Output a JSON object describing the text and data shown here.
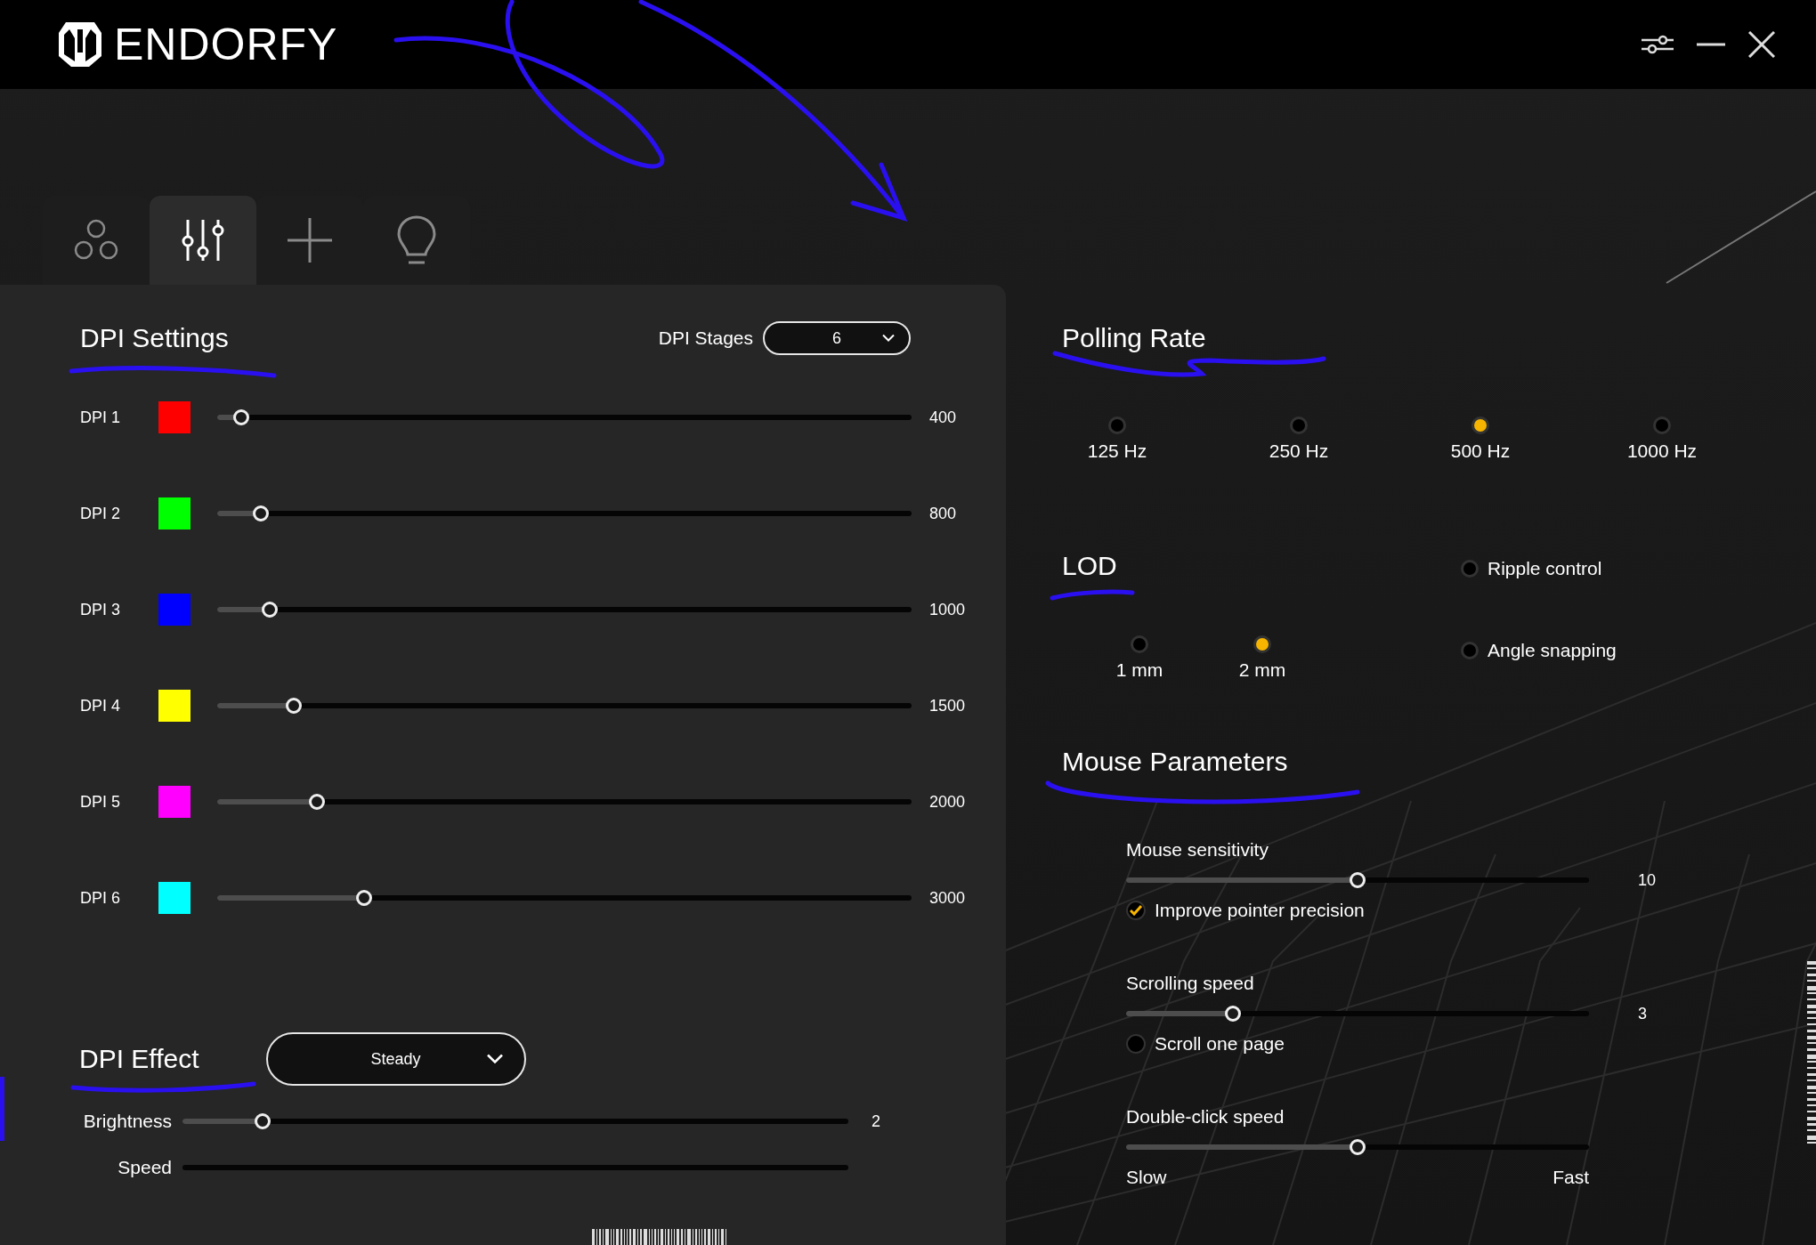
{
  "window": {
    "title": "ENDORFY"
  },
  "tabs": [
    {
      "kind": "profiles",
      "selected": false
    },
    {
      "kind": "settings",
      "selected": true
    },
    {
      "kind": "macros",
      "selected": false
    },
    {
      "kind": "lighting",
      "selected": false
    }
  ],
  "dpi_settings": {
    "title": "DPI Settings",
    "stages_label": "DPI Stages",
    "stages_value": "6",
    "stages": [
      {
        "label": "DPI 1",
        "color": "#ff0000",
        "level": 0.035,
        "value": "400"
      },
      {
        "label": "DPI 2",
        "color": "#00ff00",
        "level": 0.063,
        "value": "800"
      },
      {
        "label": "DPI 3",
        "color": "#0000ff",
        "level": 0.075,
        "value": "1000"
      },
      {
        "label": "DPI 4",
        "color": "#ffff00",
        "level": 0.11,
        "value": "1500"
      },
      {
        "label": "DPI 5",
        "color": "#ff00ff",
        "level": 0.144,
        "value": "2000"
      },
      {
        "label": "DPI 6",
        "color": "#00ffff",
        "level": 0.212,
        "value": "3000"
      }
    ]
  },
  "dpi_effect": {
    "title": "DPI Effect",
    "effect": "Steady",
    "sliders": [
      {
        "label": "Brightness",
        "level": 0.12,
        "value": "2"
      },
      {
        "label": "Speed"
      }
    ]
  },
  "polling_rate": {
    "title": "Polling Rate",
    "options": [
      {
        "label": "125 Hz",
        "selected": false
      },
      {
        "label": "250 Hz",
        "selected": false
      },
      {
        "label": "500 Hz",
        "selected": true
      },
      {
        "label": "1000 Hz",
        "selected": false
      }
    ]
  },
  "lod": {
    "title": "LOD",
    "options": [
      {
        "label": "1 mm",
        "selected": false
      },
      {
        "label": "2 mm",
        "selected": true
      }
    ]
  },
  "toggles": [
    {
      "label": "Ripple control",
      "on": false
    },
    {
      "label": "Angle snapping",
      "on": false
    }
  ],
  "mouse_parameters": {
    "title": "Mouse Parameters",
    "sensitivity": {
      "label": "Mouse sensitivity",
      "level": 0.5,
      "value": "10"
    },
    "pointer_precision": {
      "label": "Improve pointer precision",
      "checked": true
    },
    "scrolling": {
      "label": "Scrolling speed",
      "level": 0.23,
      "value": "3"
    },
    "scroll_one_page": {
      "label": "Scroll one page",
      "checked": false
    },
    "double_click": {
      "label": "Double-click speed",
      "level": 0.5,
      "min_label": "Slow",
      "max_label": "Fast"
    }
  }
}
